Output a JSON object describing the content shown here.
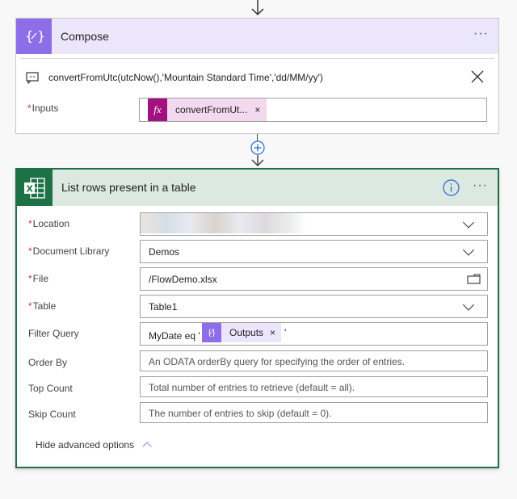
{
  "compose": {
    "title": "Compose",
    "more_label": "···",
    "comment_text": "convertFromUtc(utcNow(),'Mountain Standard Time','dd/MM/yy')",
    "inputs_label": "Inputs",
    "inputs_token": "convertFromUt...",
    "token_remove": "×",
    "colors": {
      "accent": "#8e6ee8",
      "header_bg": "#ece6fd",
      "fx": "#a2117e",
      "fx_token_bg": "#f2d9ee"
    }
  },
  "excel": {
    "title": "List rows present in a table",
    "more_label": "···",
    "colors": {
      "accent": "#1e7145",
      "header_bg": "#dbe9e1",
      "info": "#2266cc"
    },
    "fields": {
      "location": {
        "label": "Location",
        "required": true,
        "value": ""
      },
      "library": {
        "label": "Document Library",
        "required": true,
        "value": "Demos"
      },
      "file": {
        "label": "File",
        "required": true,
        "value": "/FlowDemo.xlsx"
      },
      "table": {
        "label": "Table",
        "required": true,
        "value": "Table1"
      },
      "filter": {
        "label": "Filter Query",
        "prefix": "MyDate eq '",
        "token": "Outputs",
        "suffix": "'"
      },
      "order": {
        "label": "Order By",
        "placeholder": "An ODATA orderBy query for specifying the order of entries."
      },
      "top": {
        "label": "Top Count",
        "placeholder": "Total number of entries to retrieve (default = all)."
      },
      "skip": {
        "label": "Skip Count",
        "placeholder": "The number of entries to skip (default = 0)."
      }
    },
    "hide_advanced": "Hide advanced options"
  },
  "req_mark": "*"
}
